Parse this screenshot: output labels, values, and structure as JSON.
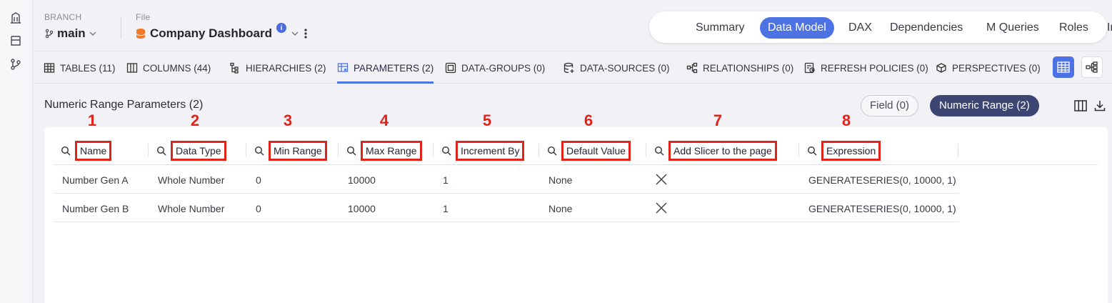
{
  "header": {
    "branch_label": "BRANCH",
    "branch_value": "main",
    "file_label": "File",
    "file_value": "Company Dashboard",
    "info_badge": "i"
  },
  "view_tabs": [
    {
      "label": "Summary",
      "active": false
    },
    {
      "label": "Data Model",
      "active": true
    },
    {
      "label": "DAX",
      "active": false
    },
    {
      "label": "Dependencies",
      "active": false
    },
    {
      "label": "M Queries",
      "active": false
    },
    {
      "label": "Roles",
      "active": false
    },
    {
      "label": "Info",
      "active": false
    }
  ],
  "subtabs": [
    {
      "label": "TABLES (11)",
      "icon": "table-icon"
    },
    {
      "label": "COLUMNS (44)",
      "icon": "columns-icon"
    },
    {
      "label": "HIERARCHIES (2)",
      "icon": "hierarchy-icon"
    },
    {
      "label": "PARAMETERS (2)",
      "icon": "parameters-icon",
      "active": true
    },
    {
      "label": "DATA-GROUPS (0)",
      "icon": "data-groups-icon"
    },
    {
      "label": "DATA-SOURCES (0)",
      "icon": "database-icon"
    },
    {
      "label": "RELATIONSHIPS (0)",
      "icon": "relationships-icon"
    },
    {
      "label": "REFRESH POLICIES (0)",
      "icon": "refresh-policy-icon"
    },
    {
      "label": "PERSPECTIVES (0)",
      "icon": "perspective-icon"
    }
  ],
  "section": {
    "title": "Numeric Range Parameters (2)",
    "filter_field": "Field (0)",
    "filter_numeric": "Numeric Range (2)"
  },
  "table": {
    "column_numbers": [
      "1",
      "2",
      "3",
      "4",
      "5",
      "6",
      "7",
      "8"
    ],
    "headers": [
      "Name",
      "Data Type",
      "Min Range",
      "Max Range",
      "Increment By",
      "Default Value",
      "Add Slicer to the page",
      "Expression"
    ],
    "rows": [
      {
        "name": "Number Gen A",
        "data_type": "Whole Number",
        "min": "0",
        "max": "10000",
        "increment": "1",
        "default": "None",
        "slicer": false,
        "expression": "GENERATESERIES(0, 10000, 1)"
      },
      {
        "name": "Number Gen B",
        "data_type": "Whole Number",
        "min": "0",
        "max": "10000",
        "increment": "1",
        "default": "None",
        "slicer": false,
        "expression": "GENERATESERIES(0, 10000, 1)"
      }
    ]
  },
  "colors": {
    "accent": "#4d72e4",
    "active_pill": "#3d4672",
    "annotation_red": "#e2231a",
    "file_icon": "#f07a2a"
  }
}
